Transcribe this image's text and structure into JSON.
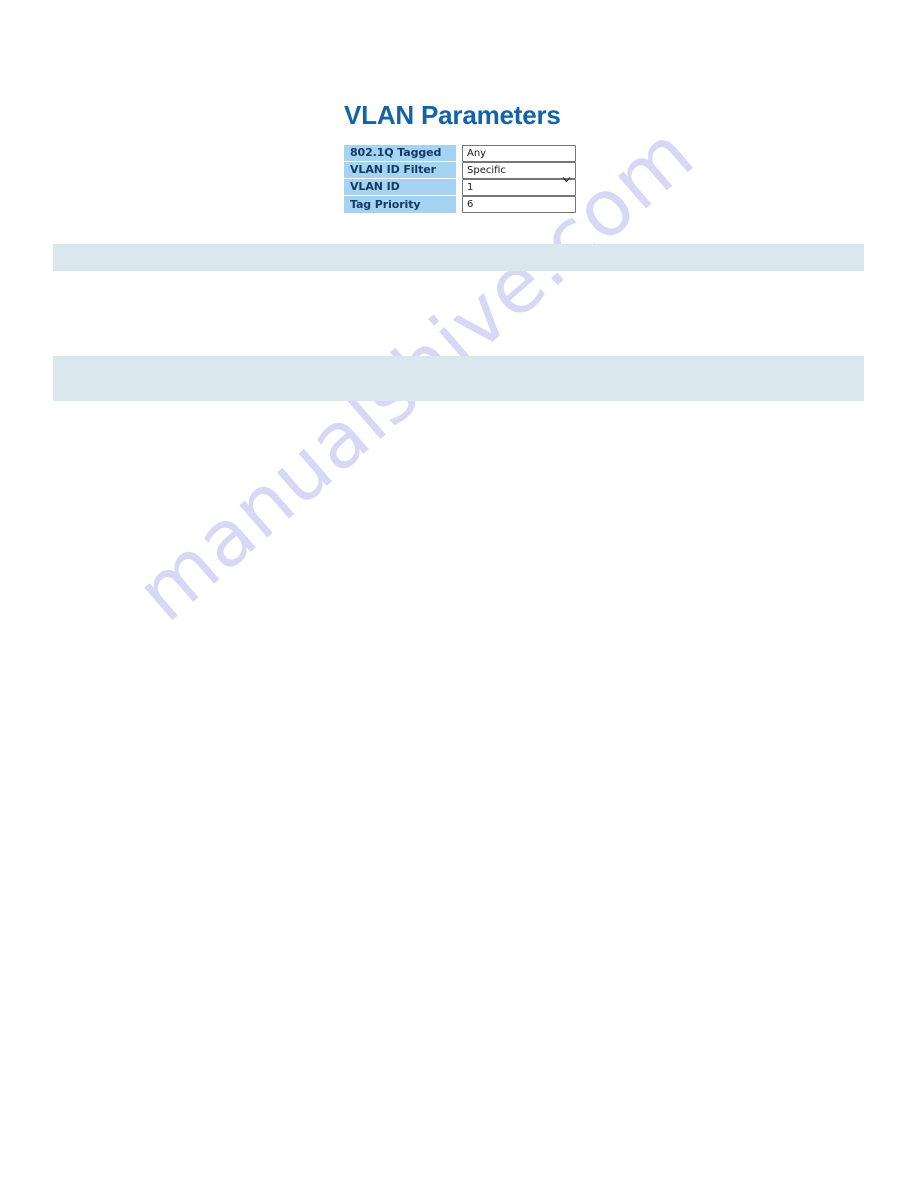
{
  "document": {
    "background_color": "#ffffff",
    "watermark_text": "manualshive.com",
    "watermark_color": "#c9ccf2"
  },
  "section": {
    "title": "VLAN Parameters",
    "title_color": "#1464a5"
  },
  "form": {
    "label_background": "#a7d3f3",
    "label_text_color": "#123a63",
    "rows": [
      {
        "label": "802.1Q Tagged",
        "control": "select",
        "value": "Any",
        "icon": "chevron-down-icon"
      },
      {
        "label": "VLAN ID Filter",
        "control": "select",
        "value": "Specific",
        "icon": "chevron-down-icon"
      },
      {
        "label": "VLAN ID",
        "control": "text",
        "value": "1",
        "icon": ""
      },
      {
        "label": "Tag Priority",
        "control": "select",
        "value": "6",
        "icon": "chevron-down-icon"
      }
    ]
  },
  "bands": {
    "color": "#dbe7ee",
    "first": {
      "text": ""
    },
    "second": {
      "text": ""
    }
  }
}
